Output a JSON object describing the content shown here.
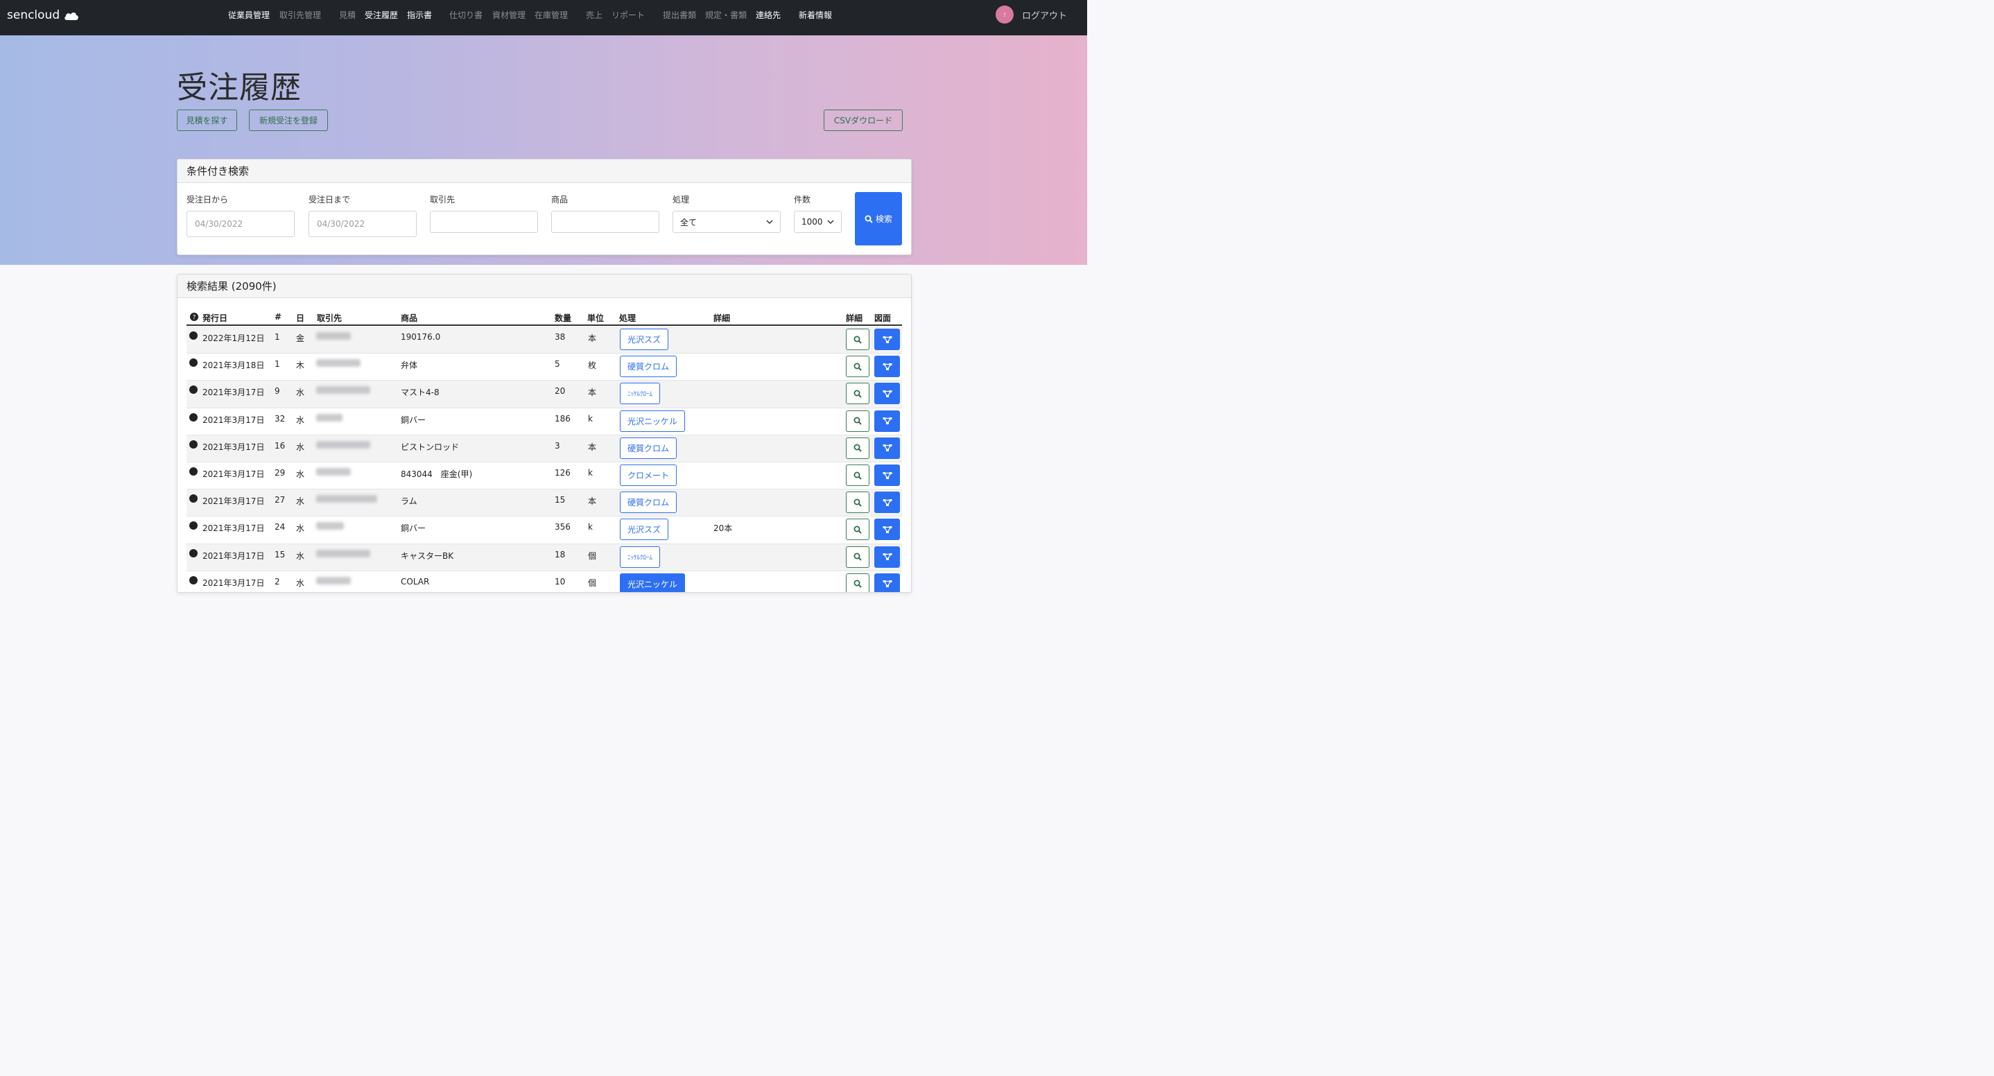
{
  "nav": {
    "brand": "sencloud",
    "links": [
      {
        "label": "従業員管理",
        "active": true
      },
      {
        "label": "取引先管理",
        "active": false
      },
      {
        "label": "見積",
        "active": false
      },
      {
        "label": "受注履歴",
        "active": true
      },
      {
        "label": "指示書",
        "active": true
      },
      {
        "label": "仕切り書",
        "active": false
      },
      {
        "label": "資材管理",
        "active": false
      },
      {
        "label": "在庫管理",
        "active": false
      },
      {
        "label": "売上",
        "active": false
      },
      {
        "label": "リポート",
        "active": false
      },
      {
        "label": "提出書類",
        "active": false
      },
      {
        "label": "規定・書類",
        "active": false
      },
      {
        "label": "連絡先",
        "active": true
      },
      {
        "label": "新着情報",
        "active": true
      }
    ],
    "avatar": "!",
    "logout": "ログアウト"
  },
  "header": {
    "title": "受注履歴",
    "find_estimate": "見積を探す",
    "new_order": "新規受注を登録",
    "csv_download": "CSVダウロード"
  },
  "search": {
    "title": "条件付き検索",
    "from_label": "受注日から",
    "from_placeholder": "04/30/2022",
    "to_label": "受注日まで",
    "to_placeholder": "04/30/2022",
    "client_label": "取引先",
    "product_label": "商品",
    "process_label": "処理",
    "process_value": "全て",
    "count_label": "件数",
    "count_value": "1000",
    "button": "検索"
  },
  "results": {
    "title": "検索結果 (2090件)",
    "columns": [
      "発行日",
      "#",
      "日",
      "取引先",
      "商品",
      "数量",
      "単位",
      "処理",
      "詳細",
      "詳細",
      "図面"
    ],
    "rows": [
      {
        "date": "2022年1月12日",
        "num": "1",
        "day": "金",
        "product": "190176.0",
        "qty": "38",
        "unit": "本",
        "process": "光沢スズ",
        "note": ""
      },
      {
        "date": "2021年3月18日",
        "num": "1",
        "day": "木",
        "product": "弁体",
        "qty": "5",
        "unit": "枚",
        "process": "硬質クロム",
        "note": ""
      },
      {
        "date": "2021年3月17日",
        "num": "9",
        "day": "水",
        "product": "マスト4-8",
        "qty": "20",
        "unit": "本",
        "process": "ﾆｯｹﾙｸﾛｰﾑ",
        "note": ""
      },
      {
        "date": "2021年3月17日",
        "num": "32",
        "day": "水",
        "product": "銅バー",
        "qty": "186",
        "unit": "k",
        "process": "光沢ニッケル",
        "note": ""
      },
      {
        "date": "2021年3月17日",
        "num": "16",
        "day": "水",
        "product": "ピストンロッド",
        "qty": "3",
        "unit": "本",
        "process": "硬質クロム",
        "note": ""
      },
      {
        "date": "2021年3月17日",
        "num": "29",
        "day": "水",
        "product": "843044　座金(甲)",
        "qty": "126",
        "unit": "k",
        "process": "クロメート",
        "note": ""
      },
      {
        "date": "2021年3月17日",
        "num": "27",
        "day": "水",
        "product": "ラム",
        "qty": "15",
        "unit": "本",
        "process": "硬質クロム",
        "note": ""
      },
      {
        "date": "2021年3月17日",
        "num": "24",
        "day": "水",
        "product": "銅バー",
        "qty": "356",
        "unit": "k",
        "process": "光沢スズ",
        "note": "20本"
      },
      {
        "date": "2021年3月17日",
        "num": "15",
        "day": "水",
        "product": "キャスターBK",
        "qty": "18",
        "unit": "個",
        "process": "ﾆｯｹﾙｸﾛｰﾑ",
        "note": ""
      },
      {
        "date": "2021年3月17日",
        "num": "2",
        "day": "水",
        "product": "COLAR",
        "qty": "10",
        "unit": "個",
        "process": "光沢ニッケル",
        "note": ""
      }
    ]
  },
  "colors": {
    "navbar": "#212529",
    "primary": "#2d6ff2",
    "success_outline": "#3c7a55"
  }
}
